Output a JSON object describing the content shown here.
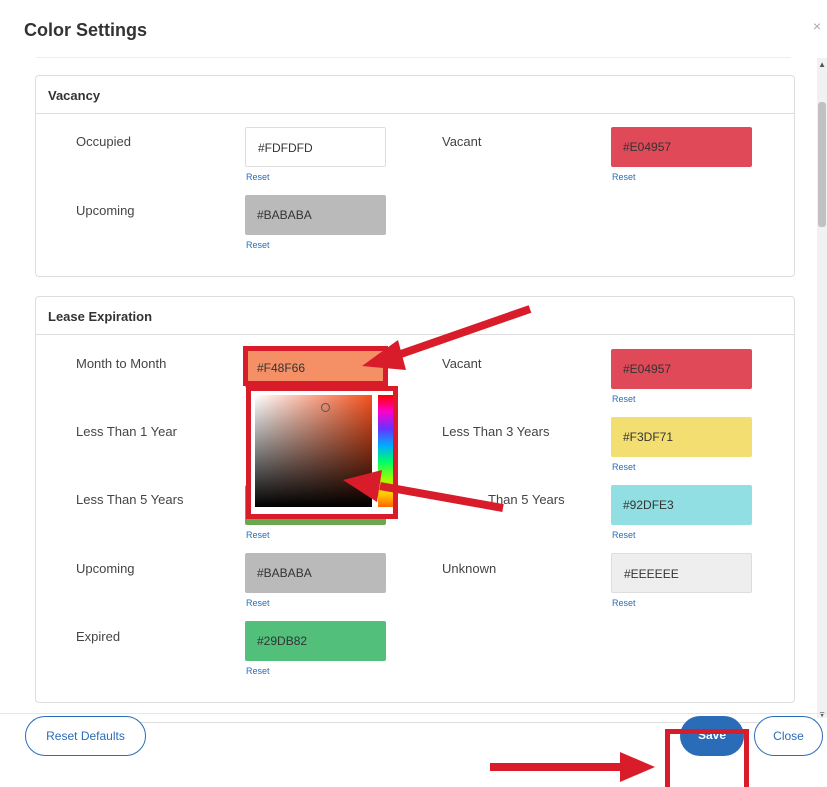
{
  "dialog": {
    "title": "Color Settings",
    "close_glyph": "×"
  },
  "vacancy": {
    "heading": "Vacancy",
    "items": [
      {
        "label": "Occupied",
        "value": "#FDFDFD",
        "color": "#FDFDFD",
        "text_color": "#333333",
        "reset": "Reset"
      },
      {
        "label": "Vacant",
        "value": "#E04957",
        "color": "#E04957",
        "text_color": "#333333",
        "reset": "Reset"
      },
      {
        "label": "Upcoming",
        "value": "#BABABA",
        "color": "#BABABA",
        "text_color": "#333333",
        "reset": "Reset"
      }
    ]
  },
  "lease": {
    "heading": "Lease Expiration",
    "items": [
      {
        "label": "Month to Month",
        "value": "#F48F66",
        "color": "#F48F66",
        "reset": "Reset"
      },
      {
        "label": "Vacant",
        "value": "#E04957",
        "color": "#E04957",
        "reset": "Reset"
      },
      {
        "label": "Less Than 1 Year",
        "value": "",
        "color": "",
        "reset": ""
      },
      {
        "label": "Less Than 3 Years",
        "value": "#F3DF71",
        "color": "#F3DF71",
        "reset": "Reset"
      },
      {
        "label": "Less Than 5 Years",
        "value": "",
        "color": "#6aa84f",
        "reset": "Reset"
      },
      {
        "label": "Than 5 Years",
        "value": "#92DFE3",
        "color": "#92DFE3",
        "reset": "Reset"
      },
      {
        "label": "Upcoming",
        "value": "#BABABA",
        "color": "#BABABA",
        "reset": "Reset"
      },
      {
        "label": "Unknown",
        "value": "#EEEEEE",
        "color": "#EEEEEE",
        "reset": "Reset"
      },
      {
        "label": "Expired",
        "value": "#29DB82",
        "color": "#29DB82",
        "reset": "Reset"
      }
    ]
  },
  "footer": {
    "reset_defaults": "Reset Defaults",
    "save": "Save",
    "close": "Close"
  },
  "colors": {
    "accent": "#2A6CB8",
    "annotation": "#D91C2A"
  },
  "icons": {
    "close": "close-icon",
    "scroll_up": "chevron-up-icon",
    "scroll_down": "chevron-down-icon"
  }
}
